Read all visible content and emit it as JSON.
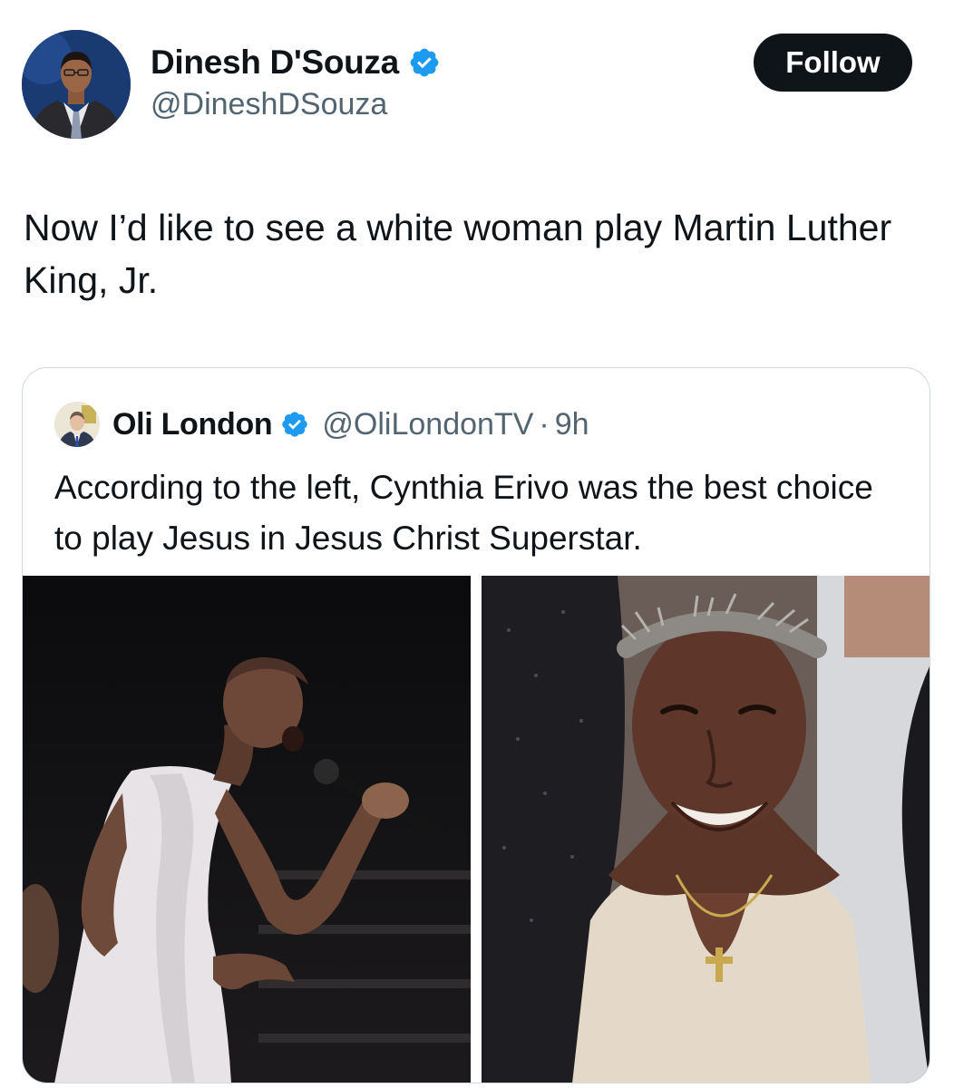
{
  "post": {
    "author": {
      "name": "Dinesh D'Souza",
      "handle": "@DineshDSouza",
      "verified": true
    },
    "follow_label": "Follow",
    "text": "Now I’d like to see a white woman play Martin Luther King, Jr."
  },
  "quoted_post": {
    "author": {
      "name": "Oli London",
      "handle": "@OliLondonTV",
      "verified": true
    },
    "separator": "·",
    "time": "9h",
    "text": "According to the left, Cynthia Erivo was the best choice to play Jesus in Jesus Christ Superstar.",
    "media": [
      {
        "icon": "photo-performer-singing-icon"
      },
      {
        "icon": "photo-performer-smiling-icon"
      }
    ]
  },
  "colors": {
    "text_primary": "#0f1419",
    "text_secondary": "#536471",
    "verified_blue": "#1d9bf0",
    "follow_bg": "#0f1419",
    "border": "#cfd9de"
  }
}
